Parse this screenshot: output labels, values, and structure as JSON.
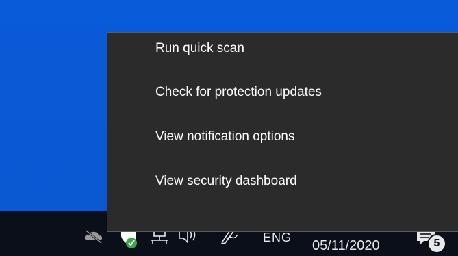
{
  "context_menu": {
    "items": [
      {
        "label": "Run quick scan"
      },
      {
        "label": "Check for protection updates"
      },
      {
        "label": "View notification options"
      },
      {
        "label": "View security dashboard"
      }
    ]
  },
  "taskbar": {
    "language": "ENG",
    "date": "05/11/2020",
    "notification_count": "5",
    "icons": [
      "onedrive-offline-icon",
      "windows-security-icon",
      "network-icon",
      "volume-icon",
      "pen-icon",
      "action-center-icon"
    ]
  },
  "colors": {
    "desktop": "#0a5bd8",
    "taskbar": "#0b0f19",
    "menu_background": "#2b2b2b",
    "menu_border": "#5a5a5a",
    "security_shield": "#ffffff",
    "security_check": "#3aa84a"
  }
}
